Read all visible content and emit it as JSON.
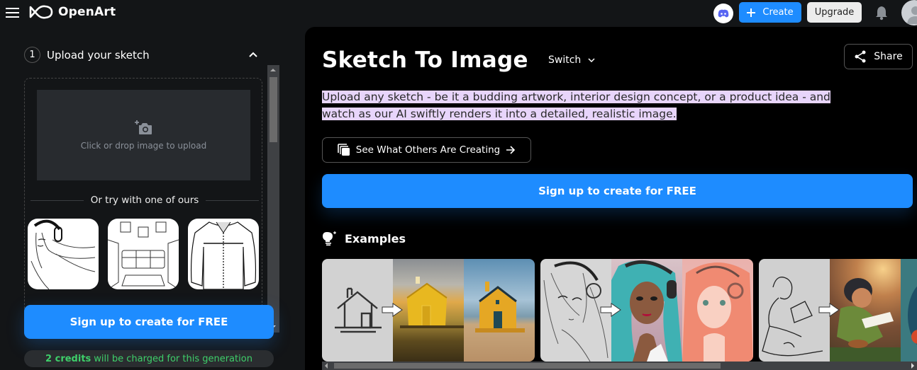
{
  "app": {
    "name": "OpenArt"
  },
  "topbar": {
    "menu_icon": "hamburger-icon",
    "discord_icon": "discord-icon",
    "create_label": "Create",
    "upgrade_label": "Upgrade",
    "notifications_icon": "bell-icon",
    "avatar_icon": "user-avatar-icon"
  },
  "sidebar": {
    "step_number": "1",
    "section_title": "Upload your sketch",
    "collapse_icon": "chevron-up-icon",
    "dropzone_text": "Click or drop image to upload",
    "dropzone_icon": "add-photo-icon",
    "samples_divider": "Or try with one of ours",
    "samples": [
      {
        "label": "anime girl with headphones sketch"
      },
      {
        "label": "living room interior sketch"
      },
      {
        "label": "jacket product sketch"
      }
    ],
    "cta_label": "Sign up to create for FREE",
    "credits_count": "2 credits",
    "credits_text": "will be charged for this generation"
  },
  "main": {
    "title": "Sketch To Image",
    "switch_label": "Switch",
    "share_label": "Share",
    "description": "Upload any sketch - be it a budding artwork, interior design concept, or a product idea - and watch as our AI swiftly renders it into a detailed, realistic image.",
    "others_label": "See What Others Are Creating",
    "cta_label": "Sign up to create for FREE",
    "examples_title": "Examples",
    "examples": [
      {
        "label": "house sketch to yellow house"
      },
      {
        "label": "anime girl sketch to portrait"
      },
      {
        "label": "reading boy sketch to 3D render"
      }
    ]
  },
  "colors": {
    "accent": "#1e8cff",
    "credits_green": "#3ecf6a",
    "highlight": "#e8d5fb",
    "sidebar_bg": "#131517",
    "main_bg": "#000000"
  }
}
